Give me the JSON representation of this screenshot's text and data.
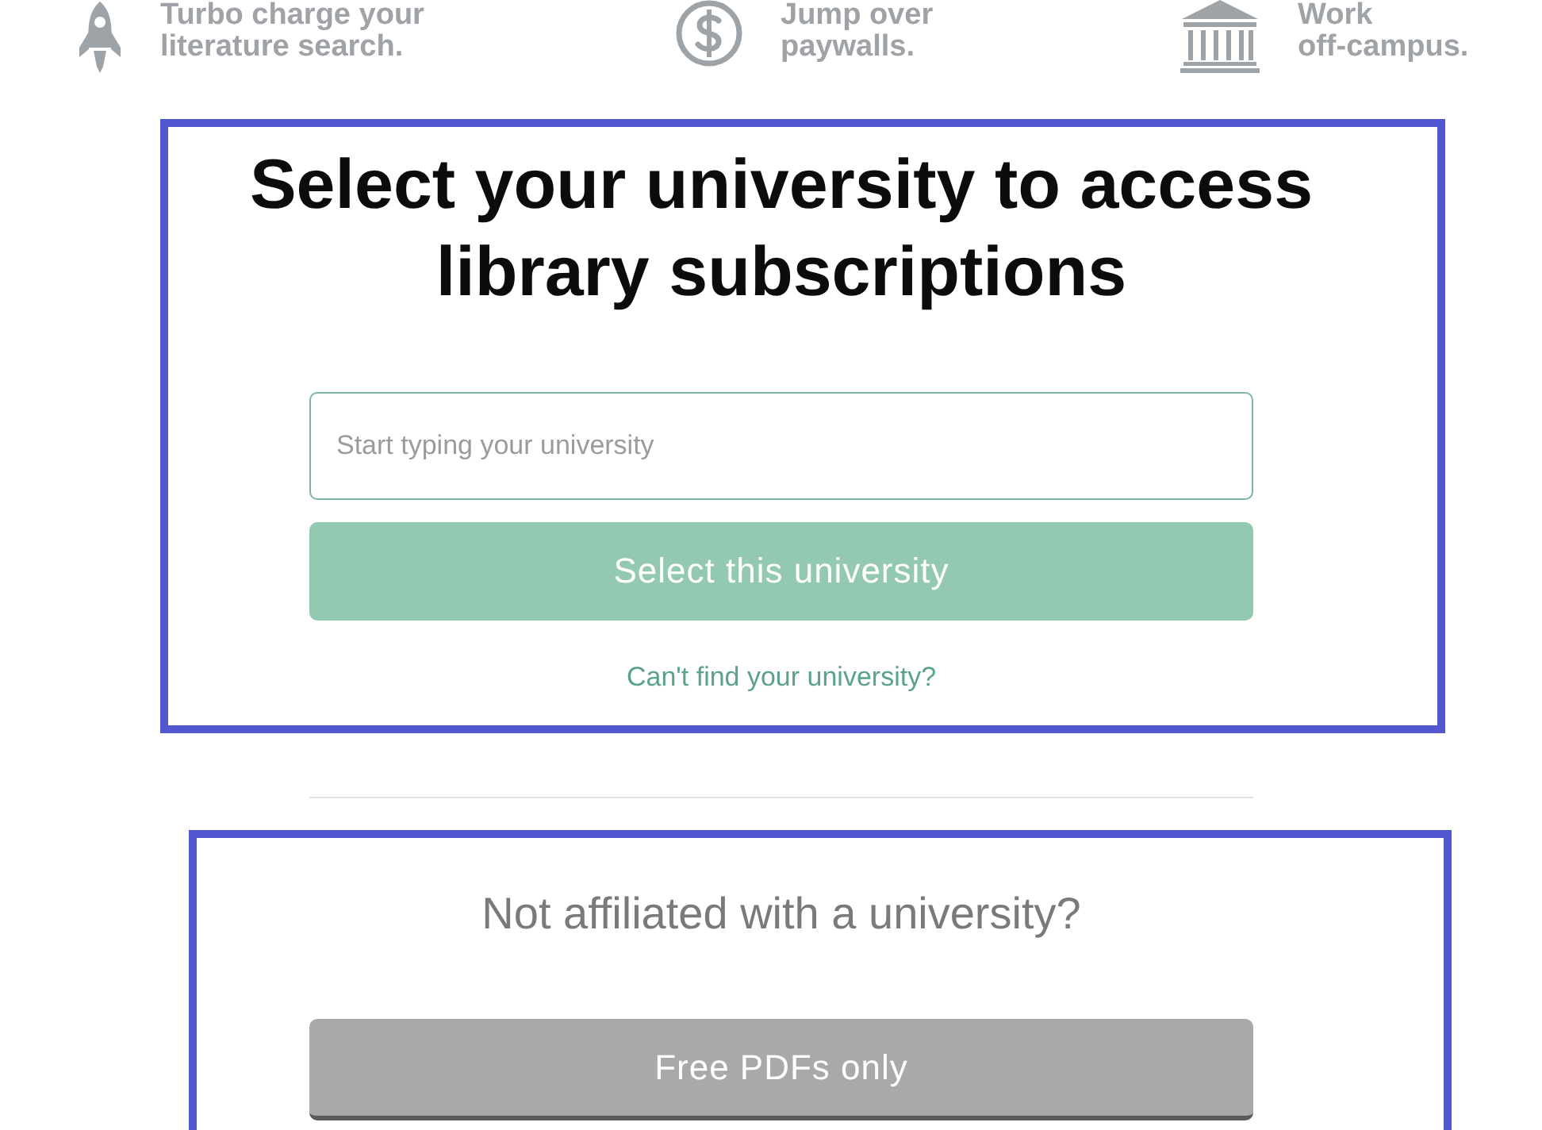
{
  "features": [
    {
      "lines": [
        "Turbo charge your",
        "literature search."
      ]
    },
    {
      "lines": [
        "Jump over",
        "paywalls."
      ]
    },
    {
      "lines": [
        "Work",
        "off-campus."
      ]
    }
  ],
  "university_panel": {
    "heading": "Select your university to access library subscriptions",
    "search": {
      "placeholder": "Start typing your university"
    },
    "select_button": {
      "label": "Select this university",
      "disabled": true
    },
    "help_link": "Can't find your university?"
  },
  "no_affiliation_panel": {
    "heading": "Not affiliated with a university?",
    "button": "Free PDFs only"
  }
}
